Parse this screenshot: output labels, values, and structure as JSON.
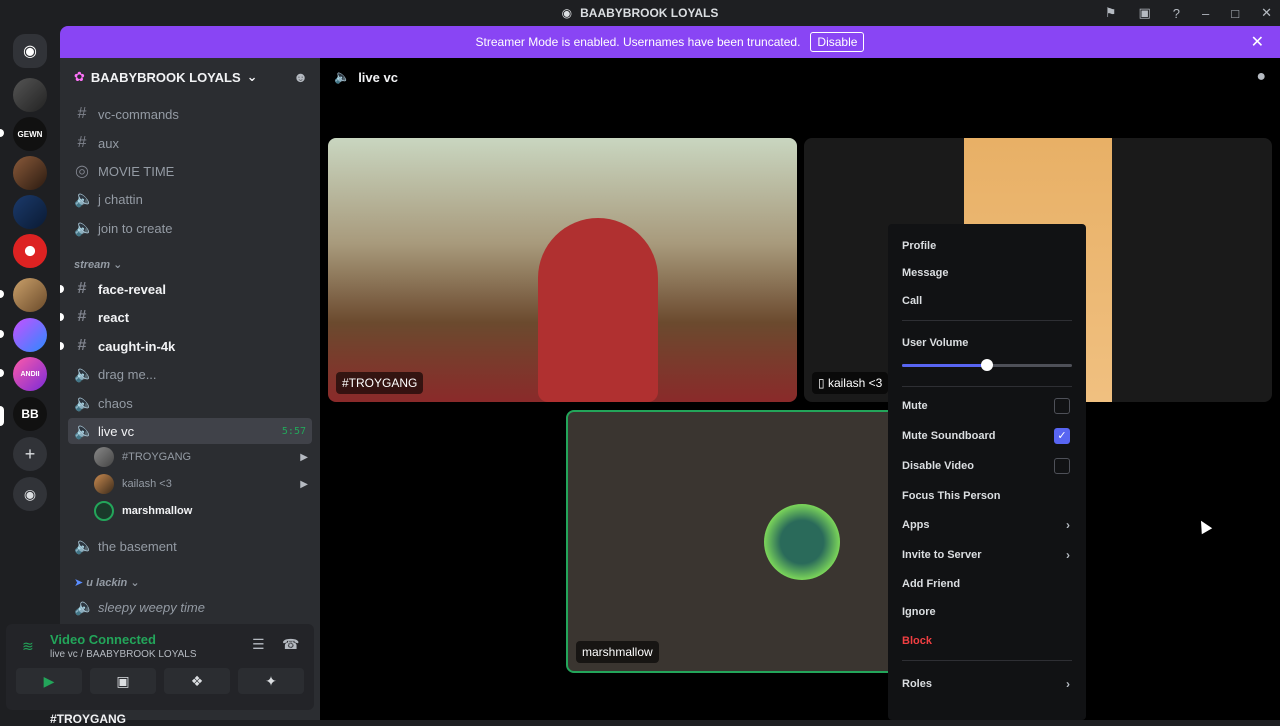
{
  "titlebar": {
    "title": "BAABYBROOK LOYALS"
  },
  "banner": {
    "text": "Streamer Mode is enabled. Usernames have been truncated.",
    "button": "Disable"
  },
  "server": {
    "name": "BAABYBROOK LOYALS"
  },
  "channels": {
    "c1": "vc-commands",
    "c2": "aux",
    "c3": "MOVIE TIME",
    "c4": "j chattin",
    "c5": "join to create",
    "cat_stream": "stream",
    "c6": "face-reveal",
    "c7": "react",
    "c8": "caught-in-4k",
    "c9": "drag me...",
    "c10": "chaos",
    "c11": "live vc",
    "c11_timer": "5:57",
    "u1": "#TROYGANG",
    "u2": "kailash <3",
    "u3": "marshmallow",
    "c12": "the basement",
    "cat_lackin": "u lackin",
    "c13": "sleepy weepy time"
  },
  "voice": {
    "status": "Video Connected",
    "location": "live vc / BAABYBROOK LOYALS"
  },
  "main": {
    "channel": "live vc"
  },
  "tiles": {
    "t1": "#TROYGANG",
    "t2": "kailash <3",
    "t3": "marshmallow"
  },
  "menu": {
    "profile": "Profile",
    "message": "Message",
    "call": "Call",
    "volume": "User Volume",
    "volume_value": 0.5,
    "mute": "Mute",
    "mute_soundboard": "Mute Soundboard",
    "disable_video": "Disable Video",
    "focus": "Focus This Person",
    "apps": "Apps",
    "invite": "Invite to Server",
    "add_friend": "Add Friend",
    "ignore": "Ignore",
    "block": "Block",
    "roles": "Roles"
  },
  "footer": {
    "user": "#TROYGANG"
  },
  "colors": {
    "accent": "#5865f2",
    "banner": "#8945f4",
    "connected": "#23a55a",
    "danger": "#f23f42"
  }
}
